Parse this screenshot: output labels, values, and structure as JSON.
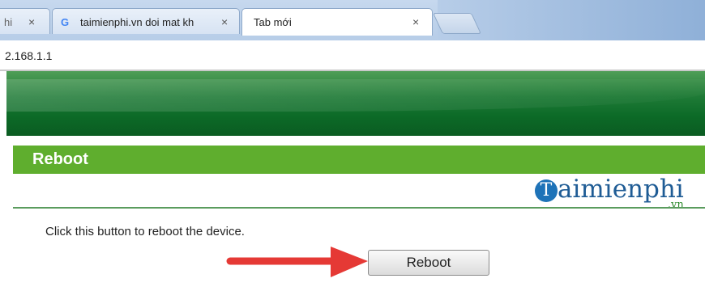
{
  "browser": {
    "tabs": [
      {
        "label": "hi",
        "close": "×"
      },
      {
        "label": "taimienphi.vn doi mat kh",
        "close": "×"
      },
      {
        "label": "Tab mới",
        "close": "×"
      }
    ],
    "address": "2.168.1.1"
  },
  "page": {
    "section_title": "Reboot",
    "logo_text": "aimienphi",
    "logo_initial": "T",
    "logo_suffix": ".vn",
    "description": "Click this button to reboot the device.",
    "reboot_button": "Reboot"
  },
  "colors": {
    "title_bar": "#5fae2e",
    "header_green": "#0c6a27",
    "arrow_red": "#e53935"
  }
}
